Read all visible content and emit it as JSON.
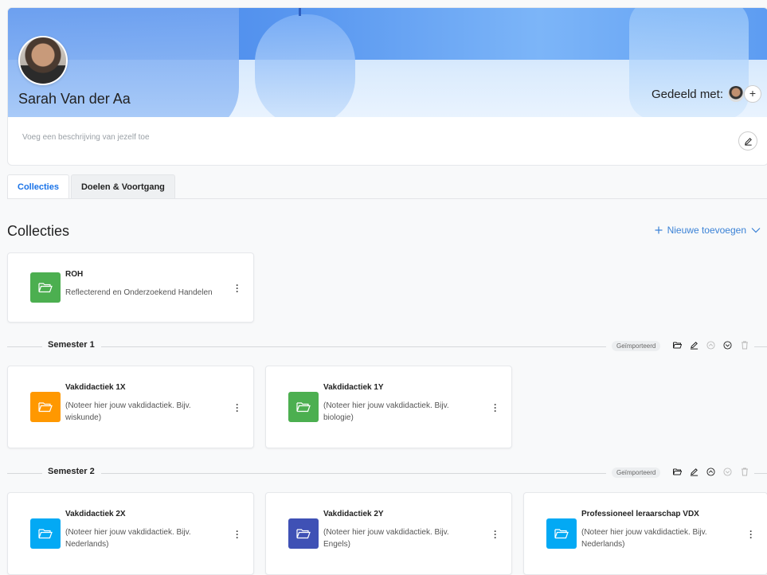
{
  "profile": {
    "name": "Sarah Van der Aa",
    "shared_label": "Gedeeld met:",
    "description_placeholder": "Voeg een beschrijving van jezelf toe"
  },
  "tabs": [
    {
      "label": "Collecties",
      "active": true
    },
    {
      "label": "Doelen & Voortgang",
      "active": false
    }
  ],
  "collections": {
    "title": "Collecties",
    "add_new_label": "Nieuwe toevoegen",
    "top_cards": [
      {
        "title": "ROH",
        "subtitle": "Reflecterend en Onderzoekend Handelen",
        "color": "#4caf50"
      }
    ]
  },
  "semesters": [
    {
      "label": "Semester 1",
      "badge": "Geïmporteerd",
      "cards": [
        {
          "title": "Vakdidactiek 1X",
          "subtitle": "(Noteer hier jouw vakdidactiek. Bijv. wiskunde)",
          "color": "#ff9800"
        },
        {
          "title": "Vakdidactiek 1Y",
          "subtitle": "(Noteer hier jouw vakdidactiek. Bijv. biologie)",
          "color": "#4caf50"
        }
      ]
    },
    {
      "label": "Semester 2",
      "badge": "Geïmporteerd",
      "cards": [
        {
          "title": "Vakdidactiek 2X",
          "subtitle": "(Noteer hier jouw vakdidactiek. Bijv. Nederlands)",
          "color": "#03a9f4"
        },
        {
          "title": "Vakdidactiek 2Y",
          "subtitle": "(Noteer hier jouw vakdidactiek. Bijv. Engels)",
          "color": "#3f51b5"
        },
        {
          "title": "Professioneel leraarschap VDX",
          "subtitle": "(Noteer hier jouw vakdidactiek. Bijv. Nederlands)",
          "color": "#03a9f4"
        }
      ]
    }
  ],
  "icons": {
    "folder": "folder-icon",
    "kebab": "more-vertical-icon",
    "edit": "pencil-icon",
    "plus": "plus-icon",
    "chevron_down": "chevron-down-icon"
  }
}
